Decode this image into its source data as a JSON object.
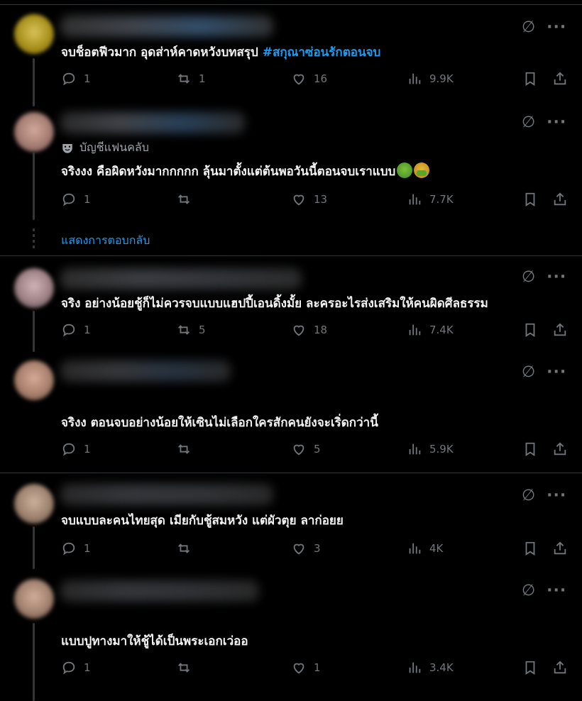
{
  "replies_link": "แสดงการตอบกลับ",
  "posts": [
    {
      "text": "จบช็อตฟีวมาก อุดส่าห์คาดหวังบทสรุป",
      "hashtag": "#สกุณาซ่อนรักตอนจบ",
      "replies": "1",
      "reposts": "1",
      "likes": "16",
      "views": "9.9K"
    },
    {
      "badge": "บัญชีแฟนคลับ",
      "text": "จริงงง คือผิดหวังมากกกกก  ลุ้นมาตั้งแต่ต้นพอวันนี้ตอนจบเราแบบ",
      "emojis": [
        "nauseated-face",
        "vomiting-face"
      ],
      "replies": "1",
      "reposts": "",
      "likes": "13",
      "views": "7.7K"
    },
    {
      "text": "จริง อย่างน้อยชู้ก็ไม่ควรจบแบบแฮปปี้เอนดิ้งมั้ย ละครอะไรส่งเสริมให้คนผิดศีลธรรม",
      "replies": "1",
      "reposts": "5",
      "likes": "18",
      "views": "7.4K"
    },
    {
      "text": "จริงง ตอนจบอย่างน้อยให้เซินไม่เลือกใครสักคนยังจะเริ่ดกว่านี้",
      "replies": "1",
      "reposts": "",
      "likes": "5",
      "views": "5.9K"
    },
    {
      "text": "จบแบบละคนไทยสุด เมียกับชู้สมหวัง แต่ผัวตุย ลาก่อยย",
      "replies": "1",
      "reposts": "",
      "likes": "3",
      "views": "4K"
    },
    {
      "text": "แบบปูทางมาให้ชู้ได้เป็นพระเอกเว่ออ",
      "replies": "1",
      "reposts": "",
      "likes": "1",
      "views": "3.4K"
    }
  ],
  "colors": {
    "background": "#000000",
    "text": "#e7e9ea",
    "muted": "#71767b",
    "accent": "#1d9bf0",
    "divider": "#2f3336"
  }
}
